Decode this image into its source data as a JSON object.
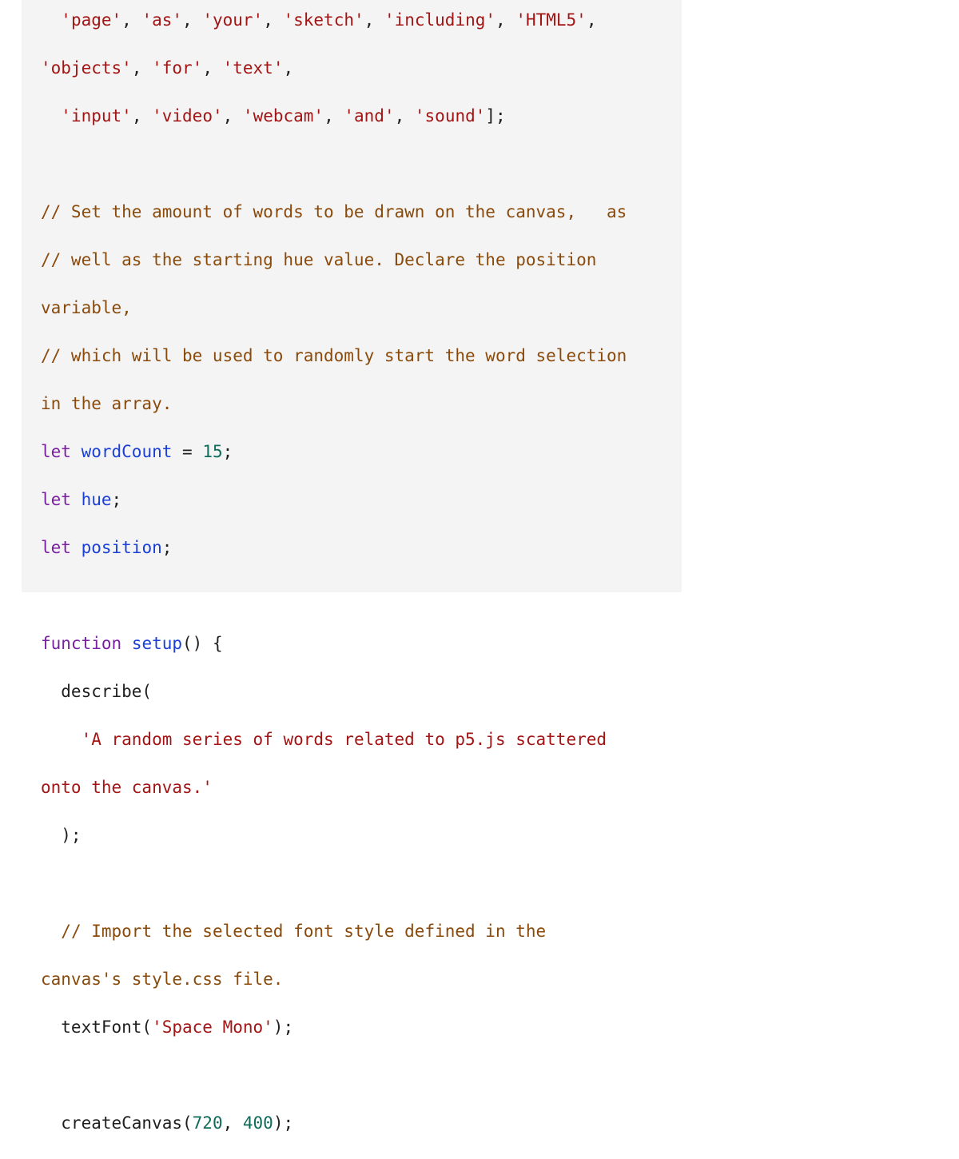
{
  "code": {
    "line1": {
      "s1": "'page'",
      "p1": ", ",
      "s2": "'as'",
      "p2": ", ",
      "s3": "'your'",
      "p3": ", ",
      "s4": "'sketch'",
      "p4": ", ",
      "s5": "'including'",
      "p5": ", ",
      "s6": "'HTML5'",
      "p6": ","
    },
    "line2": {
      "s1": "'objects'",
      "p1": ", ",
      "s2": "'for'",
      "p2": ", ",
      "s3": "'text'",
      "p3": ","
    },
    "line3": {
      "indent": "  ",
      "s1": "'input'",
      "p1": ", ",
      "s2": "'video'",
      "p2": ", ",
      "s3": "'webcam'",
      "p3": ", ",
      "s4": "'and'",
      "p4": ", ",
      "s5": "'sound'",
      "p5": "];"
    },
    "comment1": "// Set the amount of words to be drawn on the canvas,   as",
    "comment2": "// well as the starting hue value. Declare the position",
    "comment3": "variable,",
    "comment4": "// which will be used to randomly start the word selection",
    "comment5": "in the array.",
    "let1": {
      "kw": "let",
      "name": "wordCount",
      "op": " = ",
      "num": "15",
      "end": ";"
    },
    "let2": {
      "kw": "let",
      "name": "hue",
      "end": ";"
    },
    "let3": {
      "kw": "let",
      "name": "position",
      "end": ";"
    },
    "func": {
      "kw": "function",
      "name": "setup",
      "rest": "() {"
    },
    "describe_open": "  describe(",
    "describe_str1": "'A random series of words related to p5.js scattered",
    "describe_str2": "onto the canvas.'",
    "describe_close": "  );",
    "comment6": "// Import the selected font style defined in the",
    "comment7": "canvas's style.css file.",
    "textfont": {
      "call": "  textFont(",
      "str": "'Space Mono'",
      "end": ");"
    },
    "createcanvas": {
      "call": "  createCanvas(",
      "n1": "720",
      "sep": ", ",
      "n2": "400",
      "end": ");"
    }
  }
}
